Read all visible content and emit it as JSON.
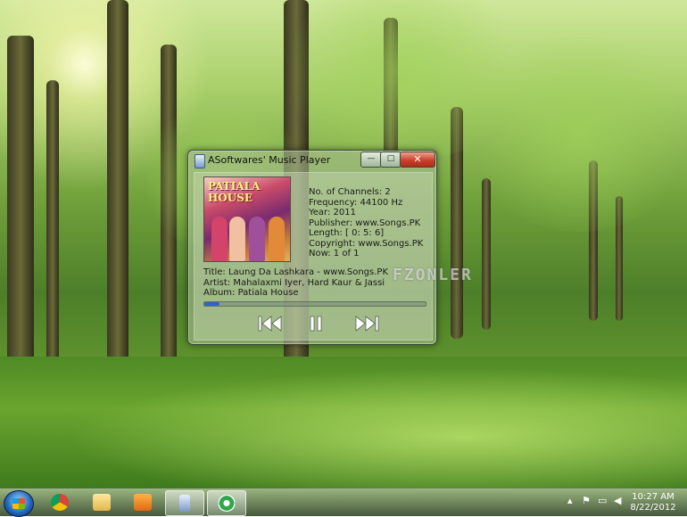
{
  "window": {
    "title": "ASoftwares' Music Player",
    "buttons": {
      "minimize": "—",
      "maximize": "□",
      "close": "✕"
    }
  },
  "album_art": {
    "title_text": "PATIALA HOUSE"
  },
  "track": {
    "channels": "No. of Channels: 2",
    "frequency": "Frequency: 44100 Hz",
    "year": "Year: 2011",
    "publisher": "Publisher: www.Songs.PK",
    "length": "Length: [ 0: 5: 6]",
    "copyright": "Copyright: www.Songs.PK",
    "now": "Now: 1 of 1",
    "title": "Title:  Laung Da Lashkara - www.Songs.PK",
    "artist": "Artist: Mahalaxmi Iyer, Hard Kaur & Jassi",
    "album": "Album:  Patiala House"
  },
  "watermark": "FZONLER",
  "progress": {
    "fraction": 0.07
  },
  "controls": {
    "previous": "previous-track",
    "pause": "pause",
    "next": "next-track"
  },
  "taskbar": {
    "items": [
      {
        "name": "chrome",
        "icon": "chrome-icon"
      },
      {
        "name": "explorer",
        "icon": "folder-icon"
      },
      {
        "name": "media-player",
        "icon": "media-player-icon"
      },
      {
        "name": "music-player",
        "icon": "music-player-icon"
      },
      {
        "name": "app",
        "icon": "green-circle-icon"
      }
    ],
    "time": "10:27 AM",
    "date": "8/22/2012"
  },
  "colors": {
    "accent": "#2d64c8",
    "close": "#c9412a"
  }
}
